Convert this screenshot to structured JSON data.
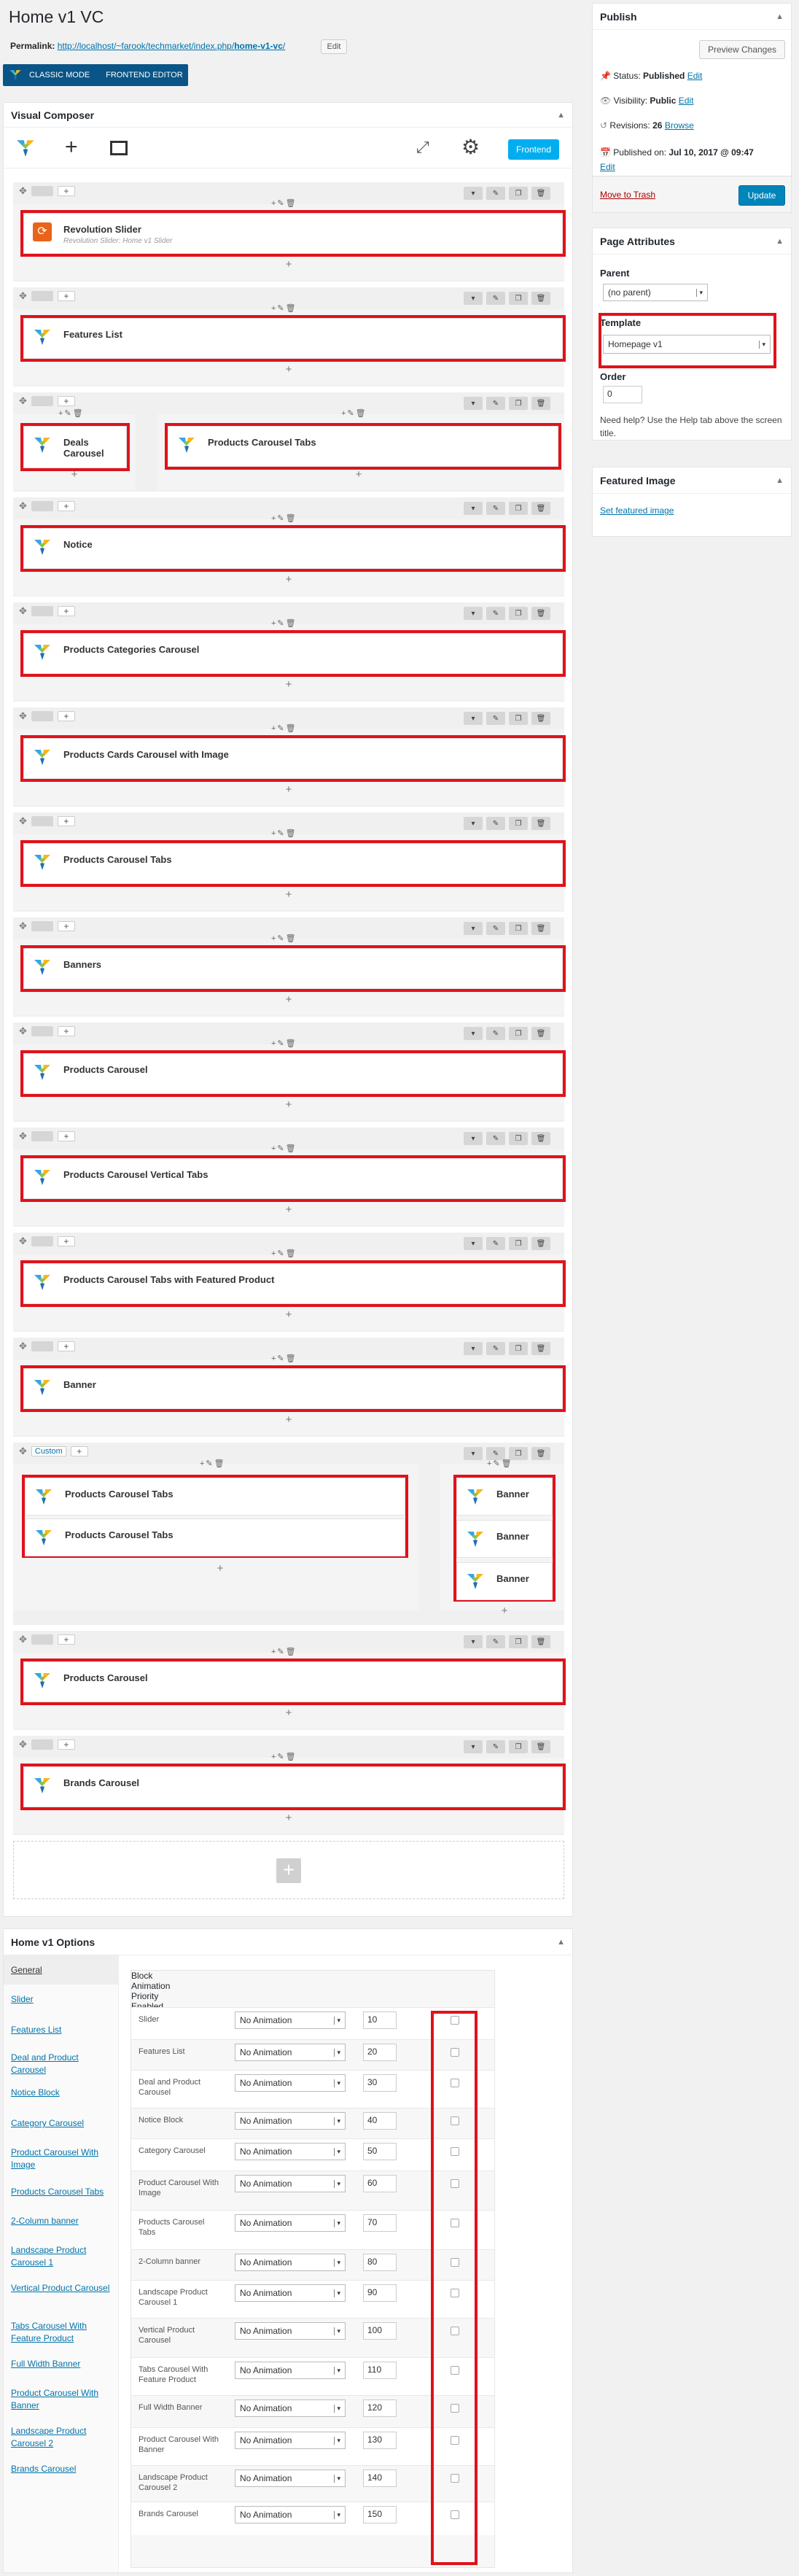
{
  "page": {
    "title": "Home v1 VC",
    "permalink_label": "Permalink:",
    "permalink_base": "http://localhost/~farook/techmarket/index.php/",
    "permalink_slug": "home-v1-vc",
    "permalink_end": "/",
    "edit_btn": "Edit"
  },
  "mode": {
    "classic": "CLASSIC MODE",
    "frontend": "FRONTEND EDITOR"
  },
  "vc": {
    "title": "Visual Composer",
    "frontend_btn": "Frontend",
    "custom_label": "Custom"
  },
  "elements": {
    "e1": "Revolution Slider",
    "e1sub": "Revolution Slider: Home v1 Slider",
    "e2": "Features List",
    "e3": "Deals Carousel",
    "e4": "Products Carousel Tabs",
    "e5": "Notice",
    "e6": "Products Categories Carousel",
    "e7": "Products Cards Carousel with Image",
    "e8": "Products Carousel Tabs",
    "e9": "Banners",
    "e10": "Products Carousel",
    "e11": "Products Carousel Vertical Tabs",
    "e12": "Products Carousel Tabs with Featured Product",
    "e13": "Banner",
    "e14a": "Products Carousel Tabs",
    "e14b": "Products Carousel Tabs",
    "e14c": "Banner",
    "e14d": "Banner",
    "e14e": "Banner",
    "e15": "Products Carousel",
    "e16": "Brands Carousel"
  },
  "publish": {
    "title": "Publish",
    "preview": "Preview Changes",
    "status_label": "Status:",
    "status": "Published",
    "vis_label": "Visibility:",
    "vis": "Public",
    "rev_label": "Revisions:",
    "rev": "26",
    "browse": "Browse",
    "pub_label": "Published on:",
    "pub": "Jul 10, 2017 @ 09:47",
    "edit": "Edit",
    "trash": "Move to Trash",
    "update": "Update"
  },
  "attrs": {
    "title": "Page Attributes",
    "parent_label": "Parent",
    "parent": "(no parent)",
    "template_label": "Template",
    "template": "Homepage v1",
    "order_label": "Order",
    "order": "0",
    "help": "Need help? Use the Help tab above the screen title."
  },
  "featured": {
    "title": "Featured Image",
    "link": "Set featured image"
  },
  "options": {
    "title": "Home v1 Options",
    "tabs": [
      "General",
      "Slider",
      "Features List",
      "Deal and Product Carousel",
      "Notice Block",
      "Category Carousel",
      "Product Carousel With Image",
      "Products Carousel Tabs",
      "2-Column banner",
      "Landscape Product Carousel 1",
      "Vertical Product Carousel",
      "Tabs Carousel With Feature Product",
      "Full Width Banner",
      "Product Carousel With Banner",
      "Landscape Product Carousel 2",
      "Brands Carousel"
    ],
    "headers": {
      "block": "Block",
      "anim": "Animation",
      "prio": "Priority",
      "enabled": "Enabled ?"
    },
    "rows": [
      {
        "block": "Slider",
        "anim": "No Animation",
        "prio": "10"
      },
      {
        "block": "Features List",
        "anim": "No Animation",
        "prio": "20"
      },
      {
        "block": "Deal and Product Carousel",
        "anim": "No Animation",
        "prio": "30"
      },
      {
        "block": "Notice Block",
        "anim": "No Animation",
        "prio": "40"
      },
      {
        "block": "Category Carousel",
        "anim": "No Animation",
        "prio": "50"
      },
      {
        "block": "Product Carousel With Image",
        "anim": "No Animation",
        "prio": "60"
      },
      {
        "block": "Products Carousel Tabs",
        "anim": "No Animation",
        "prio": "70"
      },
      {
        "block": "2-Column banner",
        "anim": "No Animation",
        "prio": "80"
      },
      {
        "block": "Landscape Product Carousel 1",
        "anim": "No Animation",
        "prio": "90"
      },
      {
        "block": "Vertical Product Carousel",
        "anim": "No Animation",
        "prio": "100"
      },
      {
        "block": "Tabs Carousel With Feature Product",
        "anim": "No Animation",
        "prio": "110"
      },
      {
        "block": "Full Width Banner",
        "anim": "No Animation",
        "prio": "120"
      },
      {
        "block": "Product Carousel With Banner",
        "anim": "No Animation",
        "prio": "130"
      },
      {
        "block": "Landscape Product Carousel 2",
        "anim": "No Animation",
        "prio": "140"
      },
      {
        "block": "Brands Carousel",
        "anim": "No Animation",
        "prio": "150"
      }
    ]
  }
}
